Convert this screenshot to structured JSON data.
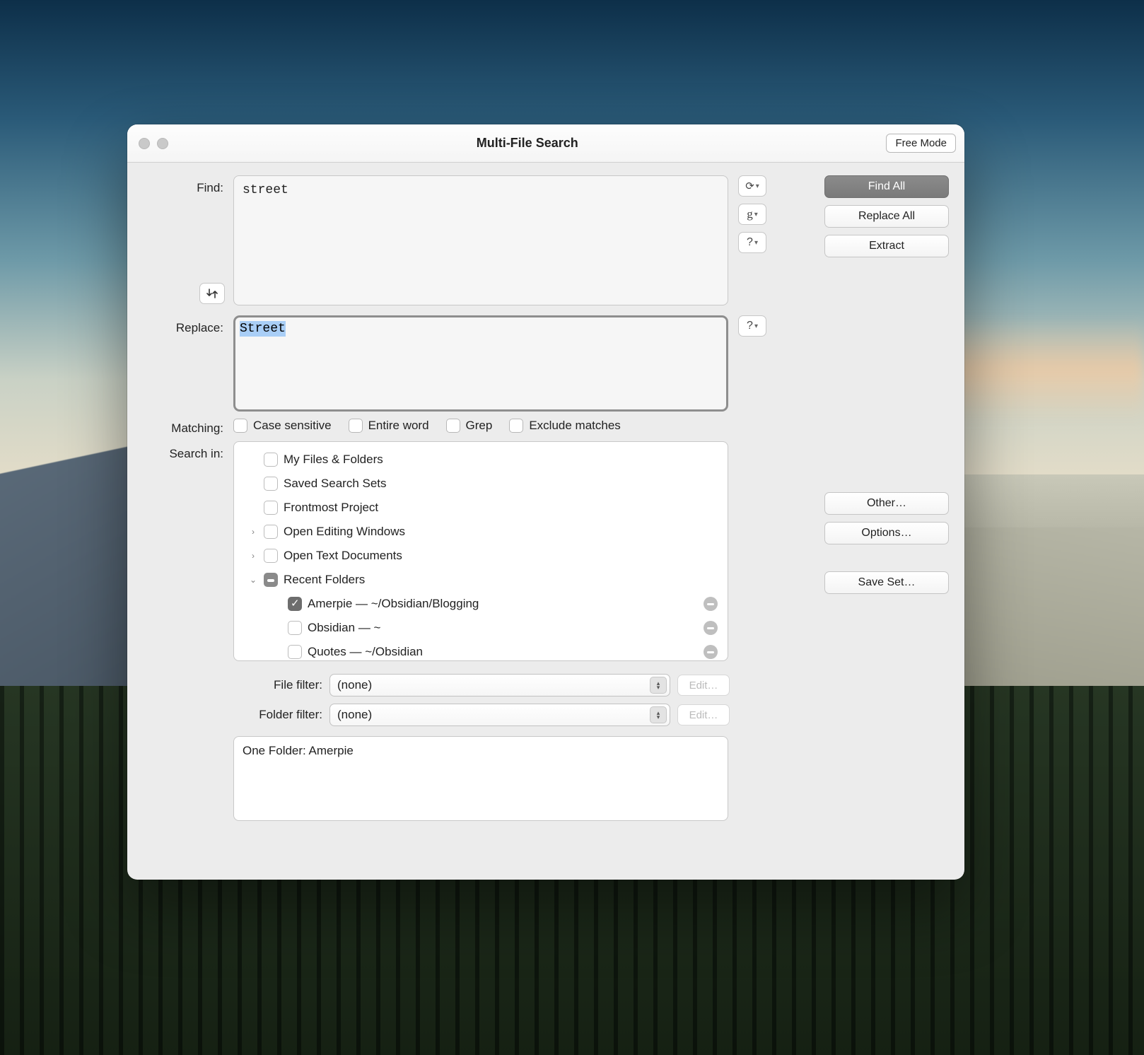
{
  "window": {
    "title": "Multi-File Search",
    "mode_badge": "Free Mode"
  },
  "labels": {
    "find": "Find:",
    "replace": "Replace:",
    "matching": "Matching:",
    "search_in": "Search in:",
    "file_filter": "File filter:",
    "folder_filter": "Folder filter:"
  },
  "find_value": "street",
  "replace_value": "Street",
  "matching_options": {
    "case_sensitive": {
      "label": "Case sensitive",
      "checked": false
    },
    "entire_word": {
      "label": "Entire word",
      "checked": false
    },
    "grep": {
      "label": "Grep",
      "checked": false
    },
    "exclude": {
      "label": "Exclude matches",
      "checked": false
    }
  },
  "search_in_tree": [
    {
      "label": "My Files & Folders",
      "state": "unchecked",
      "disclosure": "",
      "indent": 0,
      "removable": false
    },
    {
      "label": "Saved Search Sets",
      "state": "unchecked",
      "disclosure": "",
      "indent": 0,
      "removable": false
    },
    {
      "label": "Frontmost Project",
      "state": "unchecked",
      "disclosure": "",
      "indent": 0,
      "removable": false
    },
    {
      "label": "Open Editing Windows",
      "state": "unchecked",
      "disclosure": "closed",
      "indent": 0,
      "removable": false
    },
    {
      "label": "Open Text Documents",
      "state": "unchecked",
      "disclosure": "closed",
      "indent": 0,
      "removable": false
    },
    {
      "label": "Recent Folders",
      "state": "mixed",
      "disclosure": "open",
      "indent": 0,
      "removable": false
    },
    {
      "label": "Amerpie — ~/Obsidian/Blogging",
      "state": "checked",
      "disclosure": "",
      "indent": 1,
      "removable": true
    },
    {
      "label": "Obsidian — ~",
      "state": "unchecked",
      "disclosure": "",
      "indent": 1,
      "removable": true
    },
    {
      "label": "Quotes — ~/Obsidian",
      "state": "unchecked",
      "disclosure": "",
      "indent": 1,
      "removable": true
    }
  ],
  "filters": {
    "file": {
      "value": "(none)",
      "edit_label": "Edit…"
    },
    "folder": {
      "value": "(none)",
      "edit_label": "Edit…"
    }
  },
  "summary": "One Folder: Amerpie",
  "buttons": {
    "find_all": "Find All",
    "replace_all": "Replace All",
    "extract": "Extract",
    "other": "Other…",
    "options": "Options…",
    "save_set": "Save Set…"
  },
  "aux": {
    "history": "⟲",
    "grep": "g",
    "help": "?"
  }
}
